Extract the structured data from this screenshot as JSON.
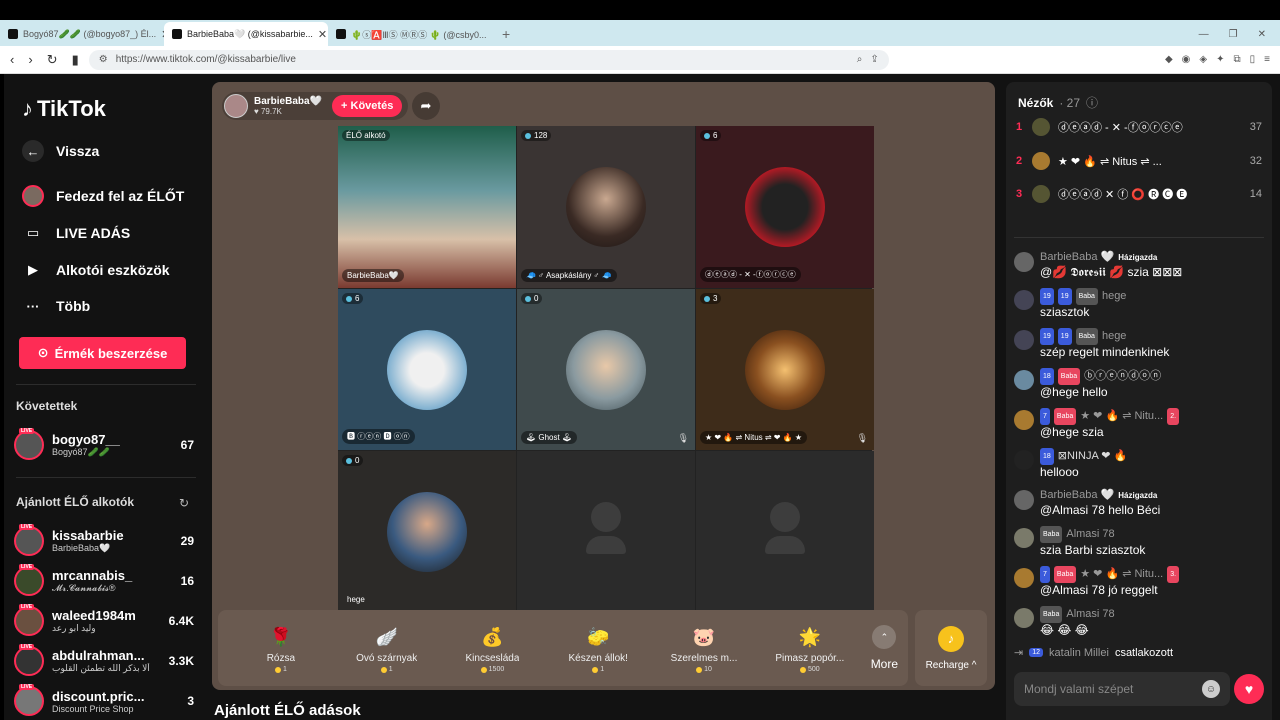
{
  "browser": {
    "tabs": [
      {
        "title": "Bogyó87🥒🥒 (@bogyo87_) Él..."
      },
      {
        "title": "BarbieBaba🤍 (@kissabarbie..."
      },
      {
        "title": "🌵ⓢ🅰️ⅢⓈ ⓂⓇⓈ 🌵 (@csby0..."
      }
    ],
    "url": "https://www.tiktok.com/@kissabarbie/live"
  },
  "sidebar": {
    "logo": "TikTok",
    "nav": [
      {
        "label": "Vissza",
        "icon": "back-arrow-icon"
      },
      {
        "label": "Fedezd fel az ÉLŐT",
        "icon": "avatar"
      },
      {
        "label": "LIVE ADÁS",
        "icon": "camera-icon"
      },
      {
        "label": "Alkotói eszközök",
        "icon": "play-icon"
      },
      {
        "label": "Több",
        "icon": "more-icon"
      }
    ],
    "coins_button": "Érmék beszerzése",
    "following_header": "Követettek",
    "following": [
      {
        "name": "bogyo87__",
        "sub": "Bogyó87🥒🥒",
        "count": "67"
      }
    ],
    "recommended_header": "Ajánlott ÉLŐ alkotók",
    "recommended": [
      {
        "name": "kissabarbie",
        "sub": "BarbieBaba🤍",
        "count": "29"
      },
      {
        "name": "mrcannabis_",
        "sub": "𝓜𝓻.𝓒𝓪𝓷𝓷𝓪𝓫𝓲𝓼®",
        "count": "16"
      },
      {
        "name": "waleed1984m",
        "sub": "وليد ابو رعد",
        "count": "6.4K"
      },
      {
        "name": "abdulrahman...",
        "sub": "ألا بذكر الله تطمئن القلوب",
        "count": "3.3K"
      },
      {
        "name": "discount.pric...",
        "sub": "Discount Price Shop",
        "count": "3"
      }
    ]
  },
  "stage": {
    "host_name": "BarbieBaba🤍",
    "host_likes": "♥ 79.7K",
    "follow_label": "+ Követés",
    "cells": [
      {
        "viewers": "ÉLŐ alkotó",
        "label": "BarbieBaba🤍"
      },
      {
        "viewers": "128",
        "label": "🧢 ♂ Asapkáslány ♂ 🧢"
      },
      {
        "viewers": "6",
        "label": "ⓓⓔⓐⓓ - ✕ -ⓕⓞⓡⓒⓔ"
      },
      {
        "viewers": "6",
        "label": "🅱 ⓡⓔⓝ 🅳 ⓞⓝ"
      },
      {
        "viewers": "0",
        "label": "🕹 Ghost 🕹"
      },
      {
        "viewers": "3",
        "label": "★ ❤ 🔥 ⇌ Nitus ⇌ ❤ 🔥 ★"
      },
      {
        "viewers": "0",
        "label": "hege"
      },
      {
        "viewers": "",
        "label": ""
      },
      {
        "viewers": "",
        "label": ""
      }
    ],
    "gifts": [
      {
        "name": "Rózsa",
        "price": "1",
        "icon": "🌹"
      },
      {
        "name": "Óvó szárnyak",
        "price": "1",
        "icon": "🪽"
      },
      {
        "name": "Kincsesláda",
        "price": "1500",
        "icon": "💰"
      },
      {
        "name": "Készen állok!",
        "price": "1",
        "icon": "🧽"
      },
      {
        "name": "Szerelmes m...",
        "price": "10",
        "icon": "🐷"
      },
      {
        "name": "Pimasz popór...",
        "price": "500",
        "icon": "🌟"
      }
    ],
    "more_label": "More",
    "recharge_label": "Recharge ^",
    "below_title": "Ajánlott ÉLŐ adások"
  },
  "chat": {
    "viewers_label": "Nézők",
    "viewers_count": "· 27",
    "top": [
      {
        "rank": "1",
        "name": "ⓓⓔⓐⓓ - ✕ -ⓕⓞⓡⓒⓔ",
        "score": "37"
      },
      {
        "rank": "2",
        "name": "★ ❤ 🔥 ⇌ Nitus ⇌ ...",
        "score": "32"
      },
      {
        "rank": "3",
        "name": "ⓓⓔⓐⓓ ✕ ⓕ ⭕ 🅡 🅒 🅔",
        "score": "14"
      }
    ],
    "messages": [
      {
        "user": "BarbieBaba 🤍",
        "badges": [],
        "tag": "Házigazda",
        "text": "@💋 𝕯𝖔𝖗𝖊𝖘𝖎𝖎 💋 szia ⊠⊠⊠"
      },
      {
        "user": "hege",
        "badges": [
          "19",
          "19",
          "Baba"
        ],
        "tag": "",
        "text": "sziasztok"
      },
      {
        "user": "hege",
        "badges": [
          "19",
          "19",
          "Baba"
        ],
        "tag": "",
        "text": "szép regelt mindenkinek"
      },
      {
        "user": "",
        "badges": [
          "18",
          "Baba",
          "ⓑⓡⓔⓝⓓⓞⓝ"
        ],
        "tag": "",
        "text": "@hege hello"
      },
      {
        "user": "★ ❤ 🔥 ⇌ Nitu...",
        "badges": [
          "7",
          "Baba",
          "2."
        ],
        "tag": "",
        "text": "@hege szia"
      },
      {
        "user": "⊠NINJA ❤ 🔥",
        "badges": [
          "18"
        ],
        "tag": "",
        "text": "hellooo"
      },
      {
        "user": "BarbieBaba 🤍",
        "badges": [],
        "tag": "Házigazda",
        "text": "@Almasi 78 hello Béci"
      },
      {
        "user": "Almasi 78",
        "badges": [
          "Baba"
        ],
        "tag": "",
        "text": "szia Barbi sziasztok"
      },
      {
        "user": "★ ❤ 🔥 ⇌ Nitu...",
        "badges": [
          "7",
          "Baba",
          "3."
        ],
        "tag": "",
        "text": "@Almasi 78 jó reggelt"
      },
      {
        "user": "Almasi 78",
        "badges": [
          "Baba"
        ],
        "tag": "",
        "text": "😂 😂 😂"
      }
    ],
    "joined": {
      "badge": "12",
      "user": "katalin Millei",
      "action": "csatlakozott"
    },
    "placeholder": "Mondj valami szépet"
  }
}
